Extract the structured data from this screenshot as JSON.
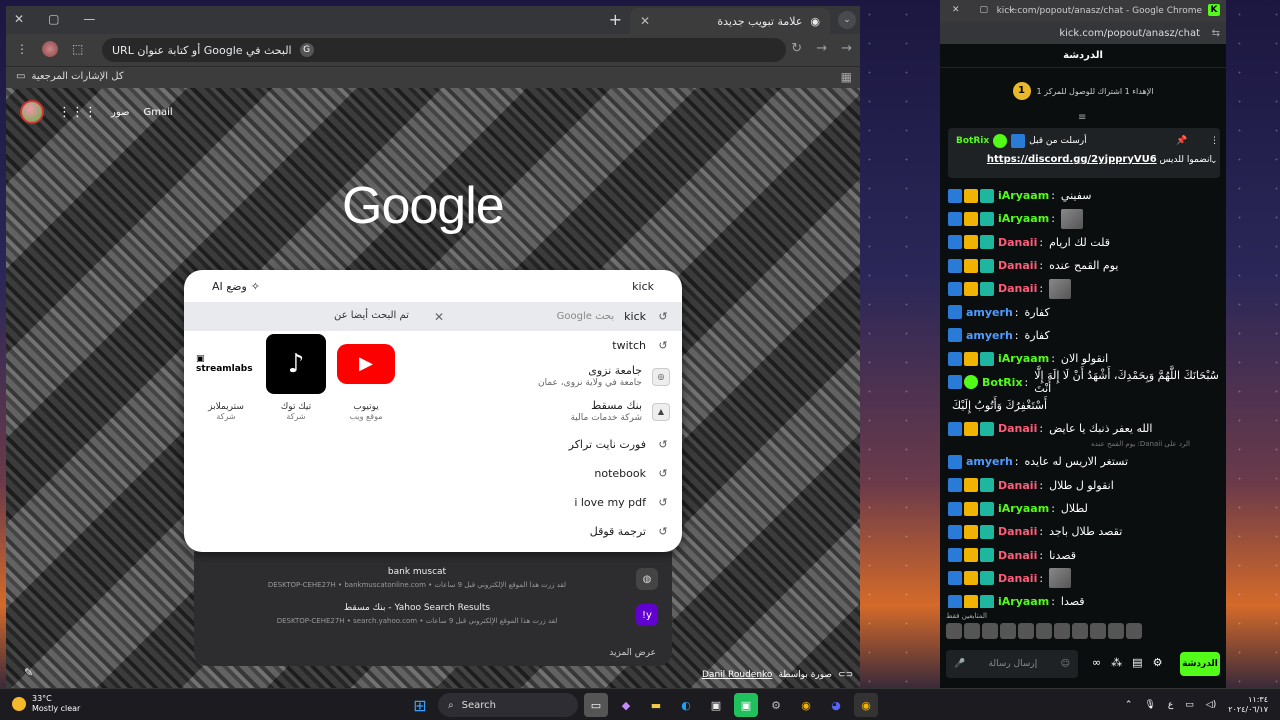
{
  "browser": {
    "tab_title": "علامة تبويب جديدة",
    "omnibox_placeholder": "البحث في Google أو كتابة عنوان URL",
    "bookmarks_all": "كل الإشارات المرجعية"
  },
  "google_page": {
    "logo": "Google",
    "gmail_link": "Gmail",
    "images_link": "صور",
    "search_query": "kick",
    "ai_mode_label": "وضع AI",
    "suggestions": [
      {
        "text": "kick",
        "hint": "بحث Google"
      },
      {
        "text": "twitch"
      },
      {
        "text": "جامعة نزوى",
        "sub": "جامعة في ولاية نزوى، عمان"
      },
      {
        "text": "بنك مسقط",
        "sub": "شركة خدمات مالية"
      },
      {
        "text": "فورت نايت تراكر"
      },
      {
        "text": "notebook"
      },
      {
        "text": "i love my pdf"
      },
      {
        "text": "ترجمة قوقل"
      }
    ],
    "people_also_search": "تم البحث أيضا عن",
    "tiles": [
      {
        "name": "يوتيوب",
        "type": "موقع ويب"
      },
      {
        "name": "تيك توك",
        "type": "شركة"
      },
      {
        "name": "ستريملابز",
        "type": "شركة"
      }
    ],
    "recent_visits": [
      {
        "title": "bank muscat",
        "detail": "لقد زرت هذا الموقع الإلكتروني قبل 9 ساعات • DESKTOP-CEHE27H • bankmuscatonline.com"
      },
      {
        "title": "Yahoo Search Results - بنك مسقط",
        "detail": "لقد زرت هذا الموقع الإلكتروني قبل 9 ساعات • DESKTOP-CEHE27H • search.yahoo.com"
      }
    ],
    "show_more": "عرض المزيد",
    "photo_credit_prefix": "صورة بواسطة",
    "photo_credit_name": "Danil Roudenko"
  },
  "kick": {
    "window_title": "kick.com/popout/anasz/chat - Google Chrome",
    "url": "kick.com/popout/anasz/chat",
    "chat_heading": "الدردشة",
    "goal_number": "1",
    "goal_text": "الإهداء 1 اشتراك للوصول للمركز 1",
    "pinned_by": "أرسلت من قبل",
    "pinned_user": "BotRix",
    "pinned_prefix": "انضموا للديس",
    "pinned_link": "https://discord.gg/2yjppryVU6",
    "messages": [
      {
        "user": "iAryaam",
        "color": "#53fc18",
        "text": "سفيني",
        "badges": [
          "sword",
          "crown",
          "sub"
        ]
      },
      {
        "user": "iAryaam",
        "color": "#53fc18",
        "text": "",
        "emote": true,
        "badges": [
          "sword",
          "crown",
          "sub"
        ]
      },
      {
        "user": "Danaii",
        "color": "#ff5c7a",
        "text": "قلت لك اريام",
        "badges": [
          "sword",
          "crown",
          "sub"
        ]
      },
      {
        "user": "Danaii",
        "color": "#ff5c7a",
        "text": "يوم القمح عنده",
        "badges": [
          "sword",
          "crown",
          "sub"
        ]
      },
      {
        "user": "Danaii",
        "color": "#ff5c7a",
        "text": "",
        "emote": true,
        "badges": [
          "sword",
          "crown",
          "sub"
        ]
      },
      {
        "user": "amyerh",
        "color": "#4f9cff",
        "text": "كفارة",
        "badges": [
          "sword"
        ]
      },
      {
        "user": "amyerh",
        "color": "#4f9cff",
        "text": "كفارة",
        "badges": [
          "sword"
        ]
      },
      {
        "user": "iAryaam",
        "color": "#53fc18",
        "text": "انقولو الان",
        "badges": [
          "sword",
          "crown",
          "sub"
        ]
      },
      {
        "user": "BotRix",
        "color": "#53fc18",
        "text": "سُبْحَانَكَ اللَّهُمَّ وَبِحَمْدِكَ، أَشْهَدُ أَنْ لَا إِلَهَ إِلَّا أَنْتَ",
        "badges": [
          "sword",
          "verified"
        ]
      },
      {
        "user": "",
        "color": "#fff",
        "text": "أَسْتَغْفِرُكَ وَأَتُوبُ إِلَيْكَ",
        "badges": []
      },
      {
        "user": "Danaii",
        "color": "#ff5c7a",
        "text": "الله يعفر ذنبك يا عايض",
        "badges": [
          "sword",
          "crown",
          "sub"
        ]
      },
      {
        "user": "amyerh",
        "color": "#4f9cff",
        "text": "تستغر الاريس له عايده",
        "badges": [
          "sword"
        ],
        "reply": "الرد على Danaii: يوم القمح عنده"
      },
      {
        "user": "Danaii",
        "color": "#ff5c7a",
        "text": "انقولو ل طلال",
        "badges": [
          "sword",
          "crown",
          "sub"
        ]
      },
      {
        "user": "iAryaam",
        "color": "#53fc18",
        "text": "لطلال",
        "badges": [
          "sword",
          "crown",
          "sub"
        ]
      },
      {
        "user": "Danaii",
        "color": "#ff5c7a",
        "text": "تقصد طلال باجد",
        "badges": [
          "sword",
          "crown",
          "sub"
        ]
      },
      {
        "user": "Danaii",
        "color": "#ff5c7a",
        "text": "قصدنا",
        "badges": [
          "sword",
          "crown",
          "sub"
        ]
      },
      {
        "user": "Danaii",
        "color": "#ff5c7a",
        "text": "",
        "emote": true,
        "badges": [
          "sword",
          "crown",
          "sub"
        ]
      },
      {
        "user": "iAryaam",
        "color": "#53fc18",
        "text": "قصدا",
        "badges": [
          "sword",
          "crown",
          "sub"
        ]
      }
    ],
    "emote_row_label": "المتابعين فقط",
    "input_placeholder": "إرسال رسالة",
    "send_label": "الدردشة"
  },
  "taskbar": {
    "temperature": "33°C",
    "weather": "Mostly clear",
    "search_label": "Search",
    "time": "١١:٣٤",
    "date": "٢٠٢٤/٠٦/١٧"
  }
}
